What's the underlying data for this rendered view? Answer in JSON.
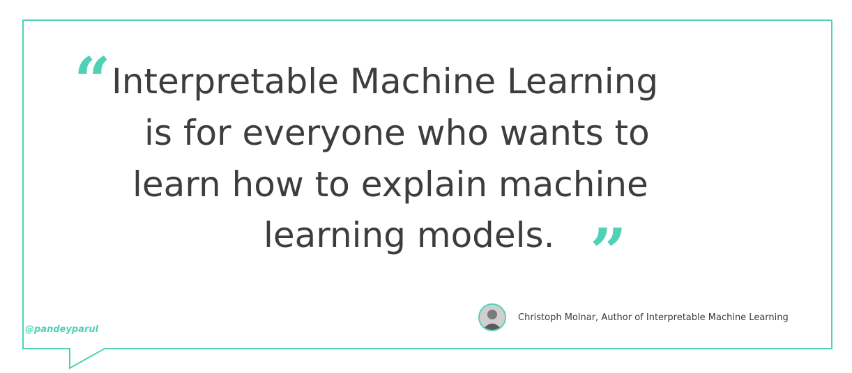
{
  "quote": {
    "open_mark": "“",
    "close_mark": "”",
    "lines": [
      "Interpretable Machine Learning",
      "is for everyone who wants to",
      "learn how to explain machine",
      "learning models."
    ]
  },
  "attribution": {
    "credit": "Christoph Molnar, Author of Interpretable Machine Learning"
  },
  "handle": "@pandeyparul",
  "colors": {
    "accent": "#4fd1b5",
    "text": "#3d3d3d"
  }
}
